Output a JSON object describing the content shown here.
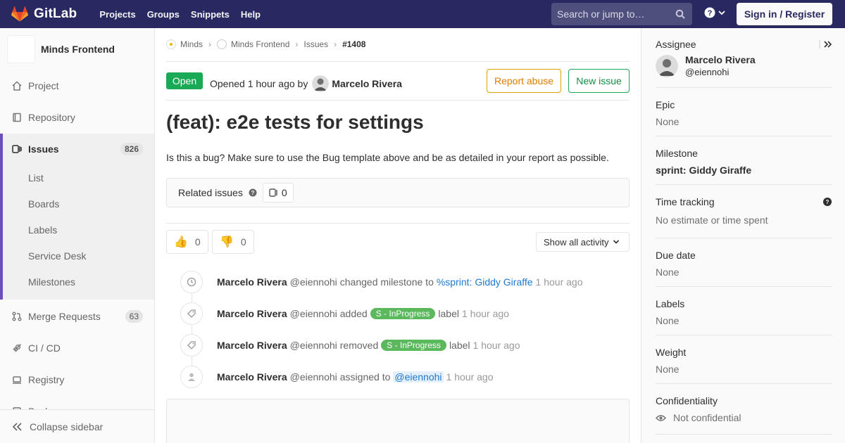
{
  "navbar": {
    "brand": "GitLab",
    "links": [
      "Projects",
      "Groups",
      "Snippets",
      "Help"
    ],
    "search_placeholder": "Search or jump to…",
    "sign_in": "Sign in / Register"
  },
  "sidebar": {
    "project_name": "Minds Frontend",
    "items": {
      "project": "Project",
      "repository": "Repository",
      "issues": "Issues",
      "issues_count": "826",
      "merge_requests": "Merge Requests",
      "merge_requests_count": "63",
      "ci_cd": "CI / CD",
      "registry": "Registry",
      "packages": "Packages"
    },
    "sub_items": [
      "List",
      "Boards",
      "Labels",
      "Service Desk",
      "Milestones"
    ],
    "collapse": "Collapse sidebar"
  },
  "breadcrumb": [
    "Minds",
    "Minds Frontend",
    "Issues",
    "#1408"
  ],
  "issue": {
    "status": "Open",
    "opened_text": "Opened 1 hour ago by",
    "author": "Marcelo Rivera",
    "report_abuse": "Report abuse",
    "new_issue": "New issue",
    "title": "(feat): e2e tests for settings",
    "description": "Is this a bug? Make sure to use the Bug template above and be as detailed in your report as possible.",
    "related_label": "Related issues",
    "related_count": "0",
    "thumbs_up": "0",
    "thumbs_down": "0",
    "activity_filter": "Show all activity"
  },
  "notes": [
    {
      "who": "Marcelo Rivera",
      "user": "@eiennohi",
      "action": "changed milestone to",
      "target": "%sprint: Giddy Giraffe",
      "suffix": "",
      "time": "1 hour ago",
      "icon": "clock-icon"
    },
    {
      "who": "Marcelo Rivera",
      "user": "@eiennohi",
      "action": "added",
      "target": "S - InProgress",
      "suffix": "label",
      "time": "1 hour ago",
      "icon": "tag-icon"
    },
    {
      "who": "Marcelo Rivera",
      "user": "@eiennohi",
      "action": "removed",
      "target": "S - InProgress",
      "suffix": "label",
      "time": "1 hour ago",
      "icon": "tag-icon"
    },
    {
      "who": "Marcelo Rivera",
      "user": "@eiennohi",
      "action": "assigned to",
      "target": "@eiennohi",
      "suffix": "",
      "time": "1 hour ago",
      "icon": "user-icon"
    }
  ],
  "right_sidebar": {
    "assignee_title": "Assignee",
    "assignee_name": "Marcelo Rivera",
    "assignee_user": "@eiennohi",
    "epic_title": "Epic",
    "epic_value": "None",
    "milestone_title": "Milestone",
    "milestone_value": "sprint: Giddy Giraffe",
    "time_title": "Time tracking",
    "time_value": "No estimate or time spent",
    "due_title": "Due date",
    "due_value": "None",
    "labels_title": "Labels",
    "labels_value": "None",
    "weight_title": "Weight",
    "weight_value": "None",
    "conf_title": "Confidentiality",
    "conf_value": "Not confidential"
  },
  "colors": {
    "navbar": "#292961",
    "open_badge": "#1aaa55",
    "label_pill": "#5cb85c",
    "active_indicator": "#6b4fbb"
  }
}
